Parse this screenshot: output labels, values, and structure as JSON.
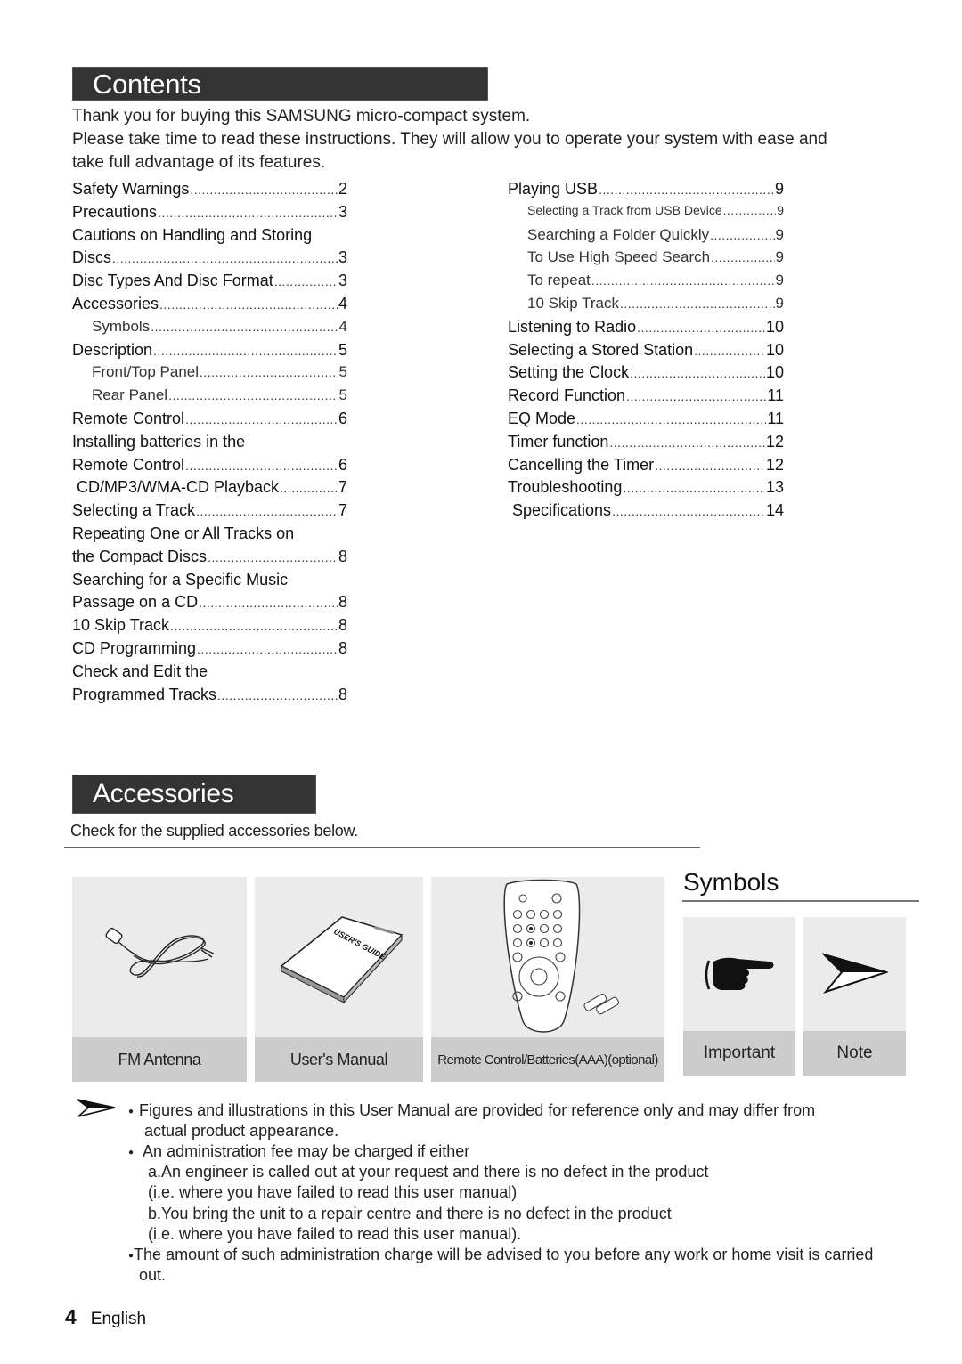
{
  "contents": {
    "title": "Contents",
    "intro": [
      "Thank you for buying this SAMSUNG micro-compact system.",
      "Please take time to read these instructions. They will allow you to operate your system with ease and",
      "take full advantage of its features."
    ],
    "left_column": [
      {
        "label": "Safety Warnings",
        "page": "2",
        "level": 0
      },
      {
        "label": "Precautions",
        "page": "3",
        "level": 0
      },
      {
        "label": "Cautions on Handling and Storing",
        "page": "",
        "level": 0
      },
      {
        "label": "Discs",
        "page": "3",
        "level": 0
      },
      {
        "label": "Disc Types And Disc Format",
        "page": "3",
        "level": 0
      },
      {
        "label": "Accessories",
        "page": "4",
        "level": 0
      },
      {
        "label": "Symbols",
        "page": "4",
        "level": 1
      },
      {
        "label": "Description",
        "page": "5",
        "level": 0
      },
      {
        "label": "Front/Top Panel",
        "page": "5",
        "level": 1
      },
      {
        "label": "Rear Panel",
        "page": "5",
        "level": 1
      },
      {
        "label": "Remote Control",
        "page": "6",
        "level": 0
      },
      {
        "label": "Installing batteries in the",
        "page": "",
        "level": 0
      },
      {
        "label": "Remote Control",
        "page": "6",
        "level": 0
      },
      {
        "label": "CD/MP3/WMA-CD Playback",
        "page": "7",
        "level": 0
      },
      {
        "label": "Selecting a Track",
        "page": "7",
        "level": 0
      },
      {
        "label": "Repeating One or All Tracks on",
        "page": "",
        "level": 0
      },
      {
        "label": "the Compact Discs",
        "page": "8",
        "level": 0
      },
      {
        "label": "Searching for a Specific Music",
        "page": "",
        "level": 0
      },
      {
        "label": "Passage on a CD",
        "page": "8",
        "level": 0
      },
      {
        "label": "10 Skip Track",
        "page": "8",
        "level": 0
      },
      {
        "label": "CD Programming",
        "page": "8",
        "level": 0
      },
      {
        "label": "Check and Edit the",
        "page": "",
        "level": 0
      },
      {
        "label": "Programmed Tracks",
        "page": "8",
        "level": 0
      }
    ],
    "right_column": [
      {
        "label": "Playing USB",
        "page": "9",
        "level": 0
      },
      {
        "label": "Selecting a Track from USB Device",
        "page": "9",
        "level": 1
      },
      {
        "label": "Searching a Folder Quickly",
        "page": "9",
        "level": 1
      },
      {
        "label": "To Use High Speed Search",
        "page": "9",
        "level": 1
      },
      {
        "label": "To repeat",
        "page": "9",
        "level": 1
      },
      {
        "label": "10 Skip Track",
        "page": "9",
        "level": 1
      },
      {
        "label": "Listening to Radio",
        "page": "10",
        "level": 0
      },
      {
        "label": "Selecting a Stored Station",
        "page": "10",
        "level": 0
      },
      {
        "label": "Setting the Clock",
        "page": "10",
        "level": 0
      },
      {
        "label": "Record Function",
        "page": "11",
        "level": 0
      },
      {
        "label": "EQ Mode",
        "page": "11",
        "level": 0
      },
      {
        "label": "Timer function",
        "page": "12",
        "level": 0
      },
      {
        "label": "Cancelling the Timer",
        "page": "12",
        "level": 0
      },
      {
        "label": "Troubleshooting",
        "page": "13",
        "level": 0
      },
      {
        "label": "Specifications",
        "page": "14",
        "level": 0
      }
    ]
  },
  "accessories": {
    "title": "Accessories",
    "intro": "Check for the supplied accessories below.",
    "items": [
      {
        "caption": "FM Antenna",
        "icon": "fm-antenna-icon"
      },
      {
        "caption": "User's Manual",
        "icon": "users-manual-icon",
        "cover_text": "USER'S GUIDE"
      },
      {
        "caption": "Remote Control/Batteries(AAA)(optional)",
        "icon": "remote-control-icon"
      }
    ]
  },
  "symbols": {
    "title": "Symbols",
    "items": [
      {
        "caption": "Important",
        "icon": "pointing-hand-icon"
      },
      {
        "caption": "Note",
        "icon": "arrow-pointer-icon"
      }
    ]
  },
  "notes": {
    "lines": [
      "Figures and illustrations in this User Manual are provided for reference only and may differ from",
      "actual product appearance.",
      "An administration fee may be charged if either",
      "a.An engineer is called out at your request and there is no defect in the product",
      "(i.e. where you have failed to read this user manual)",
      "b.You bring the unit to a repair centre and there is no defect in the product",
      "(i.e. where you have failed to read this user manual).",
      "The amount of such administration charge will be advised to you before any work or home visit is carried",
      "out."
    ]
  },
  "footer": {
    "page_number": "4",
    "language": "English"
  }
}
